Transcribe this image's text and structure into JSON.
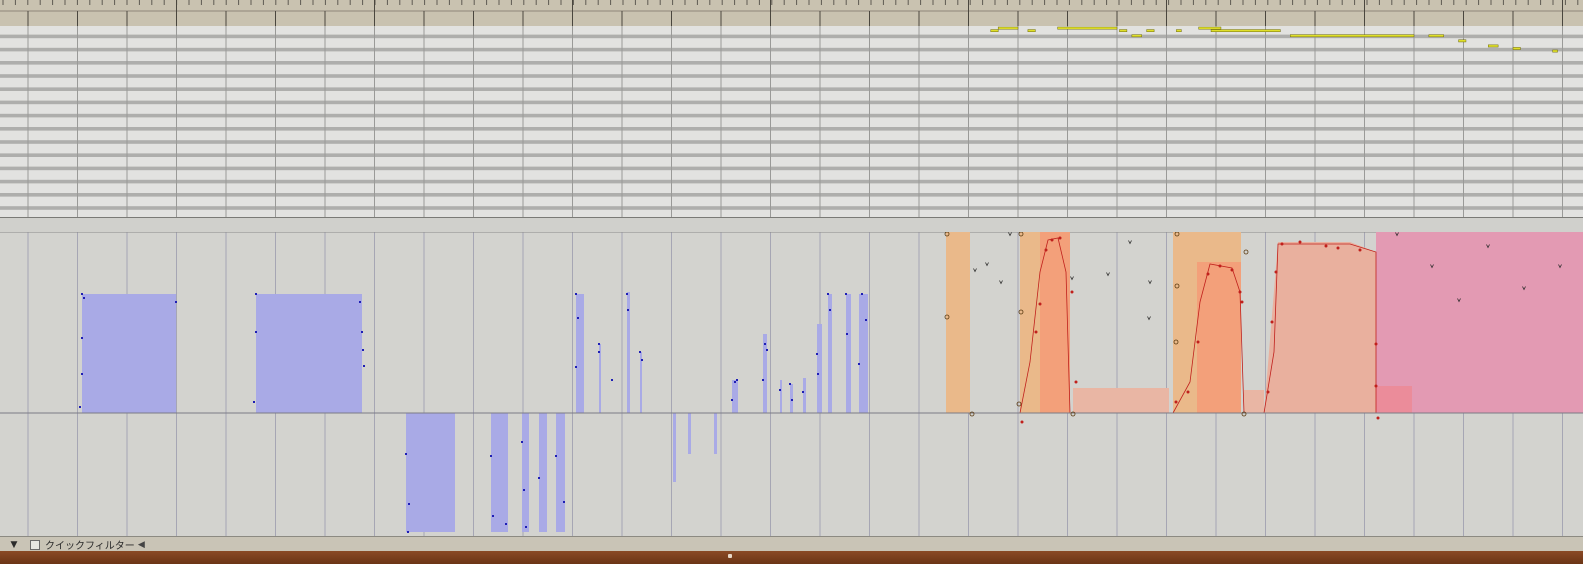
{
  "editor": {
    "footer": {
      "filter_label": "クイックフィルター"
    }
  },
  "colors": {
    "ruler_bg": "#c9c2b0",
    "note": "#e0e02a",
    "velocity_fill": "#a9aae6",
    "velocity_dot": "#1e1eb4",
    "orange_region": "#eab98a",
    "salmon_region": "#f3a07a",
    "pink_region": "#e39ab3",
    "control_point": "#c0201c"
  },
  "icons": {
    "footer_toggle": "disclosure-triangle-icon",
    "filter_menu": "caret-left-icon"
  },
  "notes": [
    {
      "start": 19.45,
      "end": 19.6,
      "pitch": 1
    },
    {
      "start": 19.6,
      "end": 20.0,
      "pitch": 0
    },
    {
      "start": 20.8,
      "end": 22.0,
      "pitch": 0
    },
    {
      "start": 20.2,
      "end": 20.35,
      "pitch": 1
    },
    {
      "start": 22.05,
      "end": 22.2,
      "pitch": 1
    },
    {
      "start": 22.3,
      "end": 22.5,
      "pitch": 3
    },
    {
      "start": 22.6,
      "end": 22.75,
      "pitch": 1
    },
    {
      "start": 23.2,
      "end": 23.3,
      "pitch": 1
    },
    {
      "start": 23.65,
      "end": 24.1,
      "pitch": 0
    },
    {
      "start": 23.9,
      "end": 25.3,
      "pitch": 1
    },
    {
      "start": 25.5,
      "end": 28.0,
      "pitch": 3
    },
    {
      "start": 28.3,
      "end": 28.6,
      "pitch": 3
    },
    {
      "start": 28.9,
      "end": 29.05,
      "pitch": 5
    },
    {
      "start": 29.5,
      "end": 29.7,
      "pitch": 7
    },
    {
      "start": 30.0,
      "end": 30.15,
      "pitch": 8
    },
    {
      "start": 30.8,
      "end": 30.9,
      "pitch": 9
    },
    {
      "start": 31.5,
      "end": 31.7,
      "pitch": 11
    }
  ]
}
